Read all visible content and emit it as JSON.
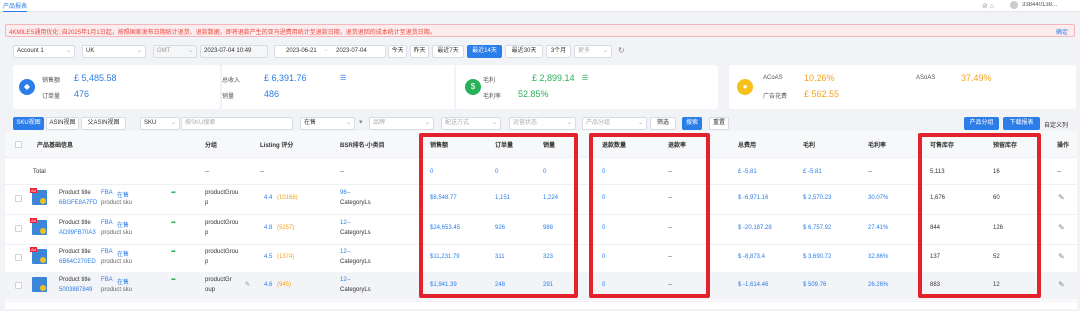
{
  "topbar": {
    "tab": "产品报表",
    "user": "338440138..."
  },
  "warning": {
    "text": "4KMILES通用优化: 自2025年1月1日起，按照国家发布日期统计退货、退款数据，即将退款产生的亚马逊费用统计至退款日期，退货退回的成本统计至退货日期。",
    "link": "确定"
  },
  "filters": {
    "account": "Account 1",
    "country": "UK",
    "tz": "GMT",
    "datetime": "2023-07-04 10:49",
    "date_start": "2023-06-21",
    "date_sep": "-",
    "date_end": "2023-07-04",
    "ranges": [
      "今天",
      "昨天",
      "最近7天",
      "最近14天",
      "最近30天",
      "3个月",
      "更多"
    ],
    "active_range": "最近14天"
  },
  "summary": {
    "sales_label": "销售额",
    "sales": "£ 5,485.58",
    "orders_label": "订单量",
    "orders": "476",
    "income_label": "总收入",
    "income": "£ 6,391.76",
    "units_label": "销量",
    "units": "486",
    "profit_label": "毛利",
    "profit": "£ 2,899.14",
    "margin_label": "毛利率",
    "margin": "52.85%",
    "acoas_label": "ACoAS",
    "acoas": "10.26%",
    "adspend_label": "广告花费",
    "adspend": "£ 562.55",
    "asoas_label": "ASoAS",
    "asoas": "37.49%"
  },
  "toolbar": {
    "views": [
      "SKU视图",
      "ASIN视图",
      "父ASIN视图"
    ],
    "sku": "SKU",
    "sku_ph": "按SKU搜索",
    "status": "在售",
    "brand": "品牌",
    "ship": "配送方式",
    "op_status": "运营状态",
    "group": "产品分组",
    "filter": "筛选",
    "search": "搜索",
    "reset": "重置",
    "group_btn": "产品分组",
    "download": "下载报表",
    "custom": "自定义列"
  },
  "columns": [
    "产品基础信息",
    "分组",
    "Listing 评分",
    "BSR排名-小类目",
    "销售额",
    "订单量",
    "销量",
    "退款数量",
    "退款率",
    "总费用",
    "毛利",
    "毛利率",
    "可售库存",
    "预留库存",
    "操作"
  ],
  "total": {
    "label": "Total",
    "group": "--",
    "rating": "--",
    "bsr": "--",
    "sales": "0",
    "orders": "0",
    "units": "0",
    "refund": "0",
    "refund_rate": "--",
    "fees": "£ -5.81",
    "profit": "£ -5.81",
    "margin": "--",
    "avail": "5,113",
    "reserved": "16",
    "op": "--"
  },
  "rows": [
    {
      "title": "Product title",
      "fba": "FBA",
      "status": "在售",
      "asin": "6BGFE8A7FD",
      "sku": "product sku",
      "group": "productGrou",
      "group2": "p",
      "rating": "4.4",
      "rcount": "(10168)",
      "bsr": "96--",
      "bsr2": "CategoryLs",
      "sales": "$8,548.77",
      "orders": "1,151",
      "units": "1,224",
      "refund": "0",
      "refund_rate": "--",
      "fees": "$ -6,971.16",
      "profit": "$ 2,570.23",
      "margin": "30.07%",
      "avail": "1,676",
      "reserved": "60"
    },
    {
      "title": "Product title",
      "fba": "FBA",
      "status": "在售",
      "asin": "AD99FB70A3",
      "sku": "product sku",
      "group": "productGrou",
      "group2": "p",
      "rating": "4.8",
      "rcount": "(5257)",
      "bsr": "12--",
      "bsr2": "CategoryLs",
      "sales": "$24,653.45",
      "orders": "926",
      "units": "988",
      "refund": "0",
      "refund_rate": "--",
      "fees": "$ -20,187.28",
      "profit": "$ 6,757.92",
      "margin": "27.41%",
      "avail": "844",
      "reserved": "126"
    },
    {
      "title": "Product title",
      "fba": "FBA",
      "status": "在售",
      "asin": "6B64C270ED",
      "sku": "product sku",
      "group": "productGrou",
      "group2": "p",
      "rating": "4.5",
      "rcount": "(1374)",
      "bsr": "12--",
      "bsr2": "CategoryLs",
      "sales": "$11,231.79",
      "orders": "311",
      "units": "323",
      "refund": "0",
      "refund_rate": "--",
      "fees": "$ -8,873.4",
      "profit": "$ 3,690.72",
      "margin": "32.86%",
      "avail": "137",
      "reserved": "52"
    },
    {
      "title": "Product title",
      "fba": "FBA",
      "status": "在售",
      "asin": "5003887849",
      "sku": "product sku",
      "group": "productGr",
      "group2": "oup",
      "rating": "4.6",
      "rcount": "(945)",
      "bsr": "12--",
      "bsr2": "CategoryLs",
      "sales": "$1,941.39",
      "orders": "248",
      "units": "291",
      "refund": "0",
      "refund_rate": "--",
      "fees": "$ -1,614.46",
      "profit": "$ 509.76",
      "margin": "26.26%",
      "avail": "883",
      "reserved": "12"
    }
  ],
  "colors": {
    "accent": "#2b7de9",
    "highlight": "#e4222d",
    "profit": "#27b158",
    "acoas": "#f5a31a"
  }
}
